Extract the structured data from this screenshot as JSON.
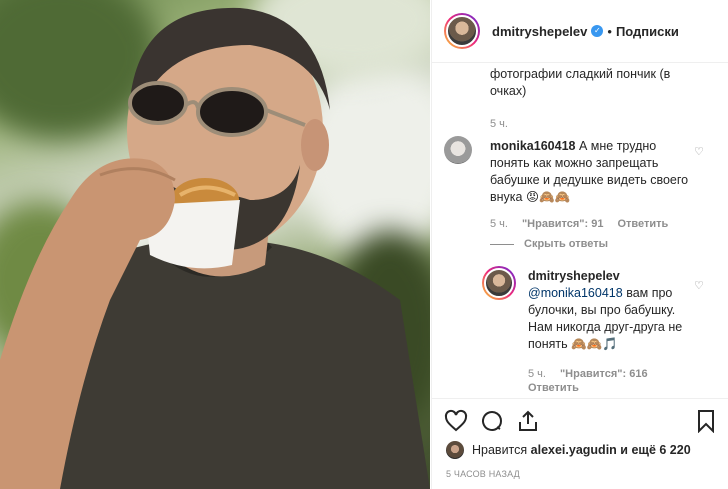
{
  "post": {
    "username": "dmitryshepelev",
    "follow_label": "Подписки"
  },
  "comments": {
    "top_partial": "фотографии сладкий пончик (в очках)",
    "top_time": "5 ч.",
    "c1": {
      "username": "monika160418",
      "text": "А мне трудно понять как можно запрещать бабушке и дедушке видеть своего внука 😡🙈🙈",
      "time": "5 ч.",
      "likes": "\"Нравится\": 91",
      "reply": "Ответить",
      "hide_replies": "Скрыть ответы"
    },
    "r1": {
      "username": "dmitryshepelev",
      "mention": "@monika160418",
      "text": "вам про булочки, вы про бабушку. Нам никогда друг-друга не понять 🙈🙈🎵",
      "time": "5 ч.",
      "likes": "\"Нравится\": 616",
      "reply": "Ответить"
    }
  },
  "footer": {
    "likes_prefix": "Нравится",
    "likes_user": "alexei.yagudin",
    "likes_suffix": "и ещё 6 220",
    "timestamp": "5 ЧАСОВ НАЗАД"
  },
  "icons": {
    "like": "heart-icon",
    "comment": "comment-icon",
    "share": "share-icon",
    "save": "bookmark-icon"
  }
}
